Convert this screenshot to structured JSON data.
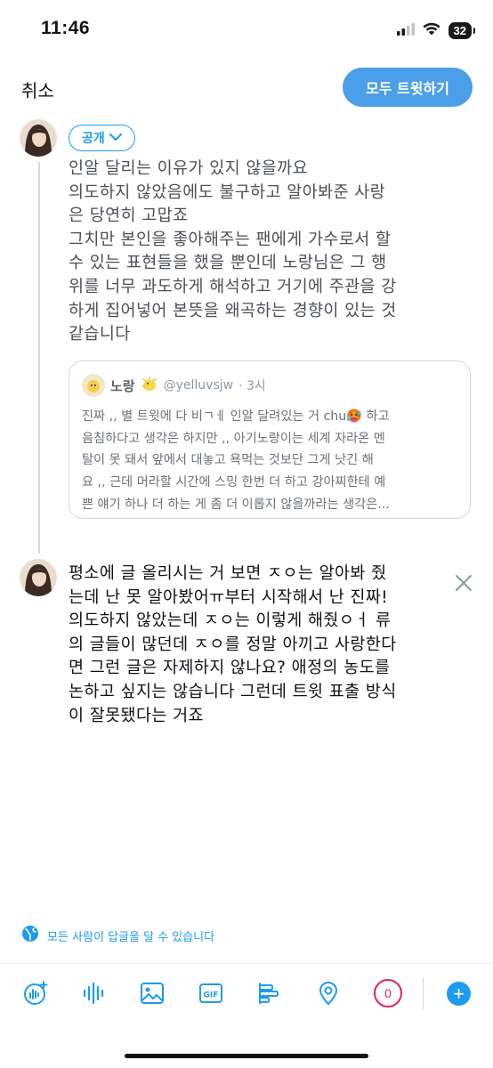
{
  "status_bar": {
    "time": "11:46",
    "battery": "32"
  },
  "header": {
    "cancel_label": "취소",
    "tweet_all_label": "모두 트윗하기"
  },
  "composer": {
    "audience_label": "공개",
    "first_tweet_lines": [
      "인알 달리는 이유가 있지 않을까요",
      "의도하지 않았음에도 불구하고 알아봐준 사랑",
      "은 당연히 고맙죠",
      "그치만 본인을 좋아해주는 팬에게 가수로서 할",
      "수 있는 표현들을 했을 뿐인데 노랑님은 그 행",
      "위를 너무 과도하게 해석하고 거기에 주관을 강",
      "하게 집어넣어 본뜻을 왜곡하는 경향이 있는 것",
      "같습니다"
    ],
    "quoted_tweet": {
      "name": "노랑",
      "handle": "@yelluvsjw",
      "time": "· 3시",
      "lines": [
        "진짜 ,, 별 트윗에 다 비ㄱㅔ 인알 달려있는 거 chu🥵 하고",
        "음침하다고 생각은 하지만 ,, 아기노랑이는 세계 자라온 멘",
        "탈이 못 돼서 앞에서 대놓고 욕먹는 것보단 그게 낫긴 해",
        "요 ,, 근데 머라할 시간에 스밍 한번 더 하고 강아찌한테 예",
        "쁜 얘기 하나 더 하는 게 좀 더 이롭지 않을까라는 생각은..."
      ]
    },
    "second_tweet_lines": [
      "평소에 글 올리시는 거 보면 ㅈㅇ는 알아봐 줬",
      "는데 난 못 알아봤어ㅠ부터 시작해서 난 진짜!",
      "의도하지 않았는데 ㅈㅇ는 이렇게 해줬ㅇㅓ 류",
      "의 글들이 많던데 ㅈㅇ를 정말 아끼고 사랑한다",
      "면 그런 글은 자제하지 않나요? 애정의 농도를",
      "논하고 싶지는 않습니다 그런데 트윗 표출 방식",
      "이 잘못됐다는 거죠"
    ],
    "reply_scope_label": "모든 사람이 답글을 달 수 있습니다"
  },
  "toolbar": {
    "gif_label": "GIF",
    "char_counter": "0",
    "icons": [
      "spaces-icon",
      "audio-icon",
      "image-icon",
      "gif-icon",
      "poll-icon",
      "location-icon"
    ]
  },
  "colors": {
    "accent": "#1d9bf0",
    "tweet_button": "#4a9fe8",
    "counter": "#e0245e"
  }
}
